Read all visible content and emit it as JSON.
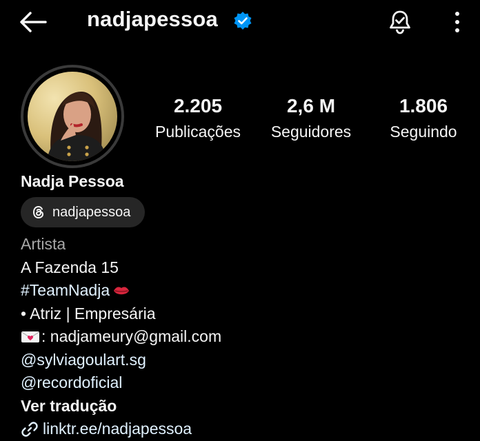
{
  "header": {
    "username": "nadjapessoa",
    "icons": [
      "back-arrow-icon",
      "verified-badge-icon",
      "notification-bell-icon",
      "more-options-icon"
    ]
  },
  "profile": {
    "display_name": "Nadja Pessoa",
    "threads_handle": "nadjapessoa"
  },
  "stats": [
    {
      "value": "2.205",
      "label": "Publicações"
    },
    {
      "value": "2,6 M",
      "label": "Seguidores"
    },
    {
      "value": "1.806",
      "label": "Seguindo"
    }
  ],
  "bio": {
    "category": "Artista",
    "line1": "A Fazenda 15",
    "line2": "#TeamNadja",
    "line3": "• Atriz | Empresária",
    "email_line": ": nadjameury@gmail.com",
    "mention1": "@sylviagoulart.sg",
    "mention2": "@recordoficial",
    "translate": "Ver tradução",
    "link": "linktr.ee/nadjapessoa"
  },
  "colors": {
    "background": "#000000",
    "verified": "#0095f6",
    "pill": "#262626",
    "muted": "#a8a8a8"
  }
}
